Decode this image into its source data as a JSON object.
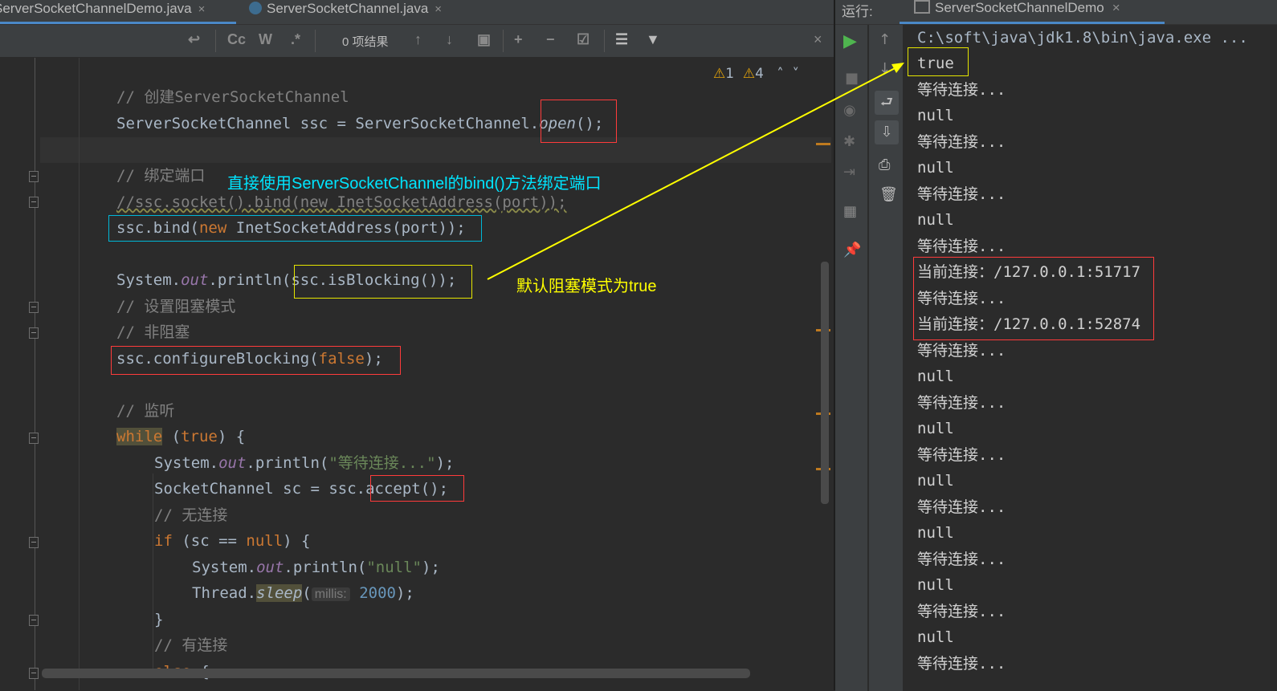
{
  "editor": {
    "tabs": [
      {
        "label": "ServerSocketChannelDemo.java",
        "close": "×"
      },
      {
        "label": "ServerSocketChannel.java",
        "close": "×"
      }
    ],
    "find": {
      "results": "0 项结果",
      "case_btn": "Cc",
      "word_btn": "W",
      "regex_btn": ".*",
      "close": "×"
    },
    "warnings": {
      "w1": "1",
      "w2": "4"
    },
    "code": {
      "l1": "// 创建ServerSocketChannel",
      "l2a": "ServerSocketChannel ssc = ServerSocketChannel.",
      "l2b": "open",
      "l2c": "();",
      "l3": "// 绑定端口",
      "l4": "//ssc.socket().bind(new InetSocketAddress(port));",
      "l5a": "ssc.bind(",
      "l5b": "new",
      "l5c": " InetSocketAddress(port));",
      "l6a": "System.",
      "l6b": "out",
      "l6c": ".println(ssc.isBlocking());",
      "l7": "// 设置阻塞模式",
      "l8": "// 非阻塞",
      "l9a": "ssc.configureBlocking(",
      "l9b": "false",
      "l9c": ");",
      "l10": "// 监听",
      "l11a": "while",
      "l11b": " (",
      "l11c": "true",
      "l11d": ") {",
      "l12a": "System.",
      "l12b": "out",
      "l12c": ".println(",
      "l12d": "\"等待连接...\"",
      "l12e": ");",
      "l13": "SocketChannel sc = ssc.accept();",
      "l14": "// 无连接",
      "l15a": "if",
      "l15b": " (sc == ",
      "l15c": "null",
      "l15d": ") {",
      "l16a": "System.",
      "l16b": "out",
      "l16c": ".println(",
      "l16d": "\"null\"",
      "l16e": ");",
      "l17a": "Thread.",
      "l17b": "sleep",
      "l17c": "(",
      "l17hint": "millis:",
      "l17d": "2000",
      "l17e": ");",
      "l18": "}",
      "l19": "// 有连接",
      "l20a": "else",
      "l20b": " {"
    },
    "annotations": {
      "bind_note": "直接使用ServerSocketChannel的bind()方法绑定端口",
      "blocking_note": "默认阻塞模式为true"
    }
  },
  "run": {
    "label": "运行:",
    "tab": "ServerSocketChannelDemo",
    "tab_close": "×",
    "output": [
      "C:\\soft\\java\\jdk1.8\\bin\\java.exe ...",
      "true",
      "等待连接...",
      "null",
      "等待连接...",
      "null",
      "等待连接...",
      "null",
      "等待连接...",
      "当前连接：/127.0.0.1:51717",
      "等待连接...",
      "当前连接：/127.0.0.1:52874",
      "等待连接...",
      "null",
      "等待连接...",
      "null",
      "等待连接...",
      "null",
      "等待连接...",
      "null",
      "等待连接...",
      "null",
      "等待连接...",
      "null",
      "等待连接..."
    ]
  },
  "colors": {
    "annotation_yellow": "#ffff00",
    "annotation_cyan": "#00e5ff",
    "box_red": "#ff3b3b",
    "keyword": "#cc7832"
  }
}
